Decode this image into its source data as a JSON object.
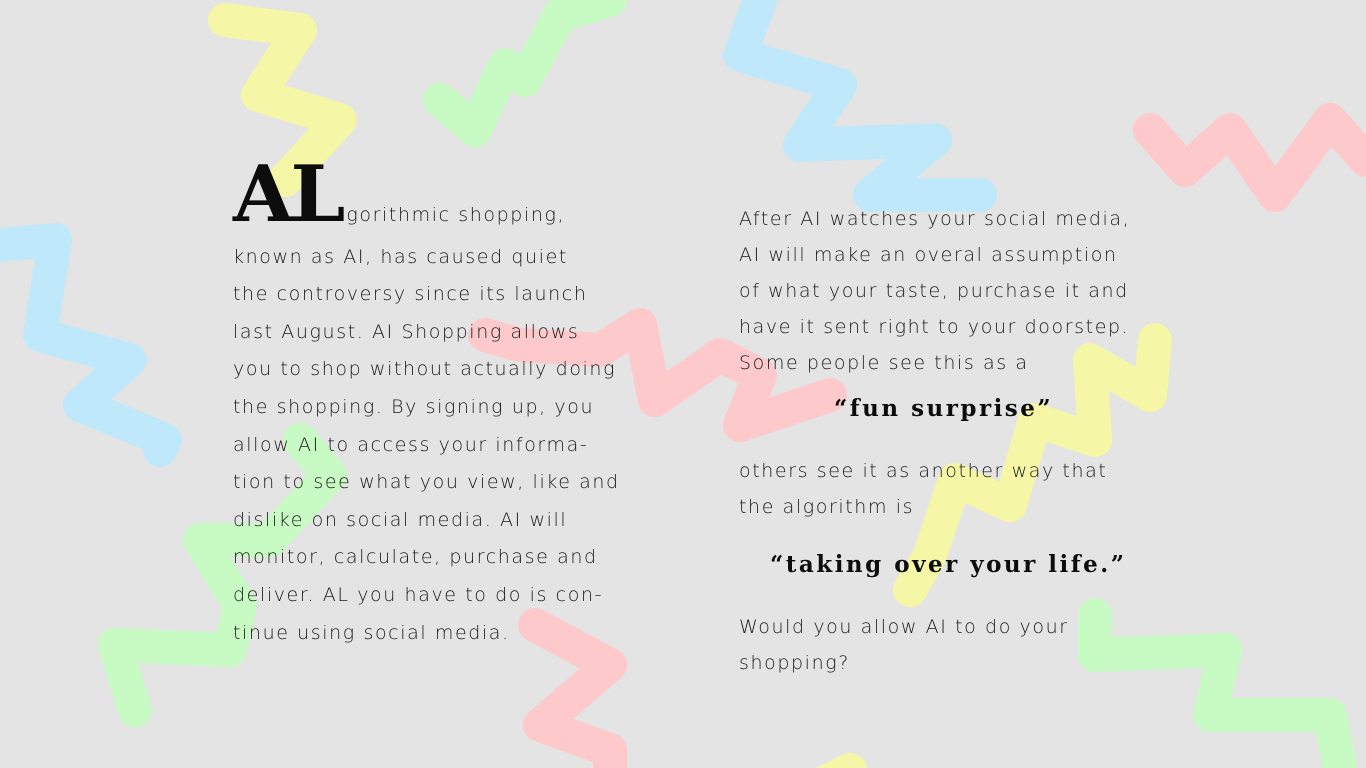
{
  "left_column": {
    "dropcap": "AL",
    "lines": [
      "gorithmic shopping,",
      "known as AI, has caused quiet",
      "the controversy since its launch",
      "last August. AI Shopping allows",
      "you to shop without actually doing",
      "the shopping. By signing up, you",
      "allow AI to access your informa-",
      "tion to see what you view, like and",
      "dislike on social media. AI will",
      "monitor, calculate, purchase and",
      "deliver. AL you have to do is con-",
      "tinue using social media."
    ]
  },
  "right_column": {
    "intro_lines": [
      "After AI watches your social media,",
      "AI will make an overal assumption",
      "of what your taste, purchase it and",
      "have it sent right to your doorstep.",
      "Some people see this as a"
    ],
    "quote_1": "“fun surprise”",
    "middle_lines": [
      "others see it as another way that",
      "the algorithm is"
    ],
    "quote_2": "“taking over your life.”",
    "closing_lines": [
      "Would you allow AI to do your",
      "shopping?"
    ]
  },
  "colors": {
    "background": "#e4e4e4",
    "yellow": "#f5f7a6",
    "green": "#c8fbc4",
    "blue": "#bfe8fb",
    "pink": "#fdc9cb",
    "text": "#1b1b1b"
  }
}
